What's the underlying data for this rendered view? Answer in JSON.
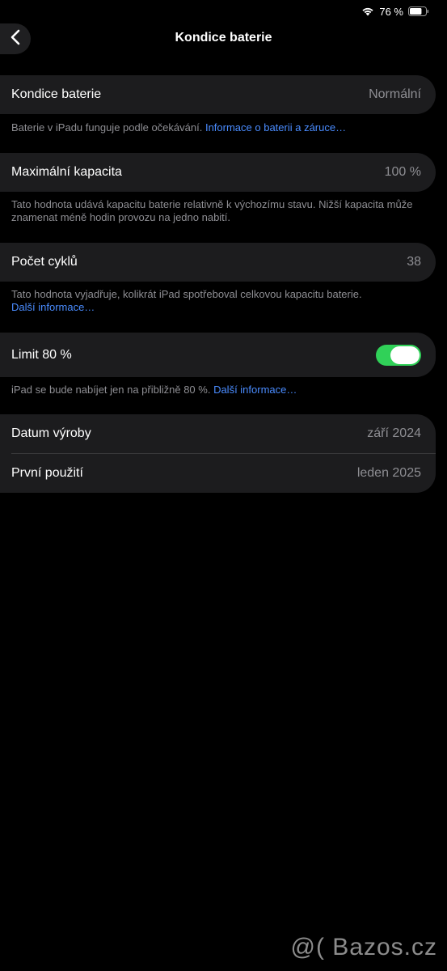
{
  "status_bar": {
    "battery_percent": "76 %",
    "battery_level": 0.76,
    "icons": [
      "wifi-icon",
      "battery-icon"
    ]
  },
  "nav": {
    "title": "Kondice baterie",
    "back_icon": "chevron-left-icon"
  },
  "sections": {
    "health": {
      "label": "Kondice baterie",
      "value": "Normální",
      "footnote_text": "Baterie v iPadu funguje podle očekávání. ",
      "footnote_link": "Informace o baterii a záruce…"
    },
    "capacity": {
      "label": "Maximální kapacita",
      "value": "100 %",
      "footnote_text": "Tato hodnota udává kapacitu baterie relativně k výchozímu stavu. Nižší kapacita může znamenat méně hodin provozu na jedno nabití."
    },
    "cycles": {
      "label": "Počet cyklů",
      "value": "38",
      "footnote_text": "Tato hodnota vyjadřuje, kolikrát iPad spotřeboval celkovou kapacitu baterie.",
      "footnote_link": "Další informace…"
    },
    "limit": {
      "label": "Limit 80 %",
      "toggle_on": true,
      "footnote_text": "iPad se bude nabíjet jen na přibližně 80 %. ",
      "footnote_link": "Další informace…"
    },
    "dates": {
      "manufacture_label": "Datum výroby",
      "manufacture_value": "září 2024",
      "first_use_label": "První použití",
      "first_use_value": "leden 2025"
    }
  },
  "watermark": "@( Bazos.cz",
  "colors": {
    "background": "#000000",
    "card": "#1c1c1e",
    "secondary_text": "#8e8e93",
    "link": "#4a8cff",
    "toggle_on": "#30d158"
  }
}
